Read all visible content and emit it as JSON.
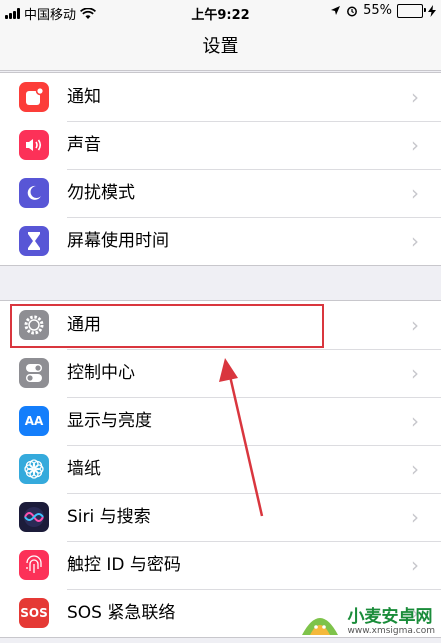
{
  "status_bar": {
    "carrier": "中国移动",
    "time": "上午9:22",
    "battery": "55%",
    "battery_level": 0.55
  },
  "nav": {
    "title": "设置"
  },
  "groups": [
    {
      "items": [
        {
          "label": "通知",
          "icon": "notifications-icon",
          "color": "#fc3d39"
        },
        {
          "label": "声音",
          "icon": "sounds-icon",
          "color": "#fc3158"
        },
        {
          "label": "勿扰模式",
          "icon": "moon-icon",
          "color": "#5856d6"
        },
        {
          "label": "屏幕使用时间",
          "icon": "hourglass-icon",
          "color": "#5856d6"
        }
      ]
    },
    {
      "items": [
        {
          "label": "通用",
          "icon": "gear-icon",
          "color": "#8e8e93"
        },
        {
          "label": "控制中心",
          "icon": "switches-icon",
          "color": "#8e8e93"
        },
        {
          "label": "显示与亮度",
          "icon": "display-aa-icon",
          "color": "#147efb",
          "icon_text": "AA"
        },
        {
          "label": "墙纸",
          "icon": "flower-icon",
          "color": "#35aadc"
        },
        {
          "label": "Siri 与搜索",
          "icon": "siri-icon",
          "color": "#1c1c3a"
        },
        {
          "label": "触控 ID 与密码",
          "icon": "fingerprint-icon",
          "color": "#fc3158"
        },
        {
          "label": "SOS 紧急联络",
          "icon": "sos-icon",
          "color": "#e53935",
          "icon_text": "SOS"
        }
      ]
    }
  ],
  "watermark": {
    "name": "小麦安卓网",
    "url": "www.xmsigma.com"
  }
}
